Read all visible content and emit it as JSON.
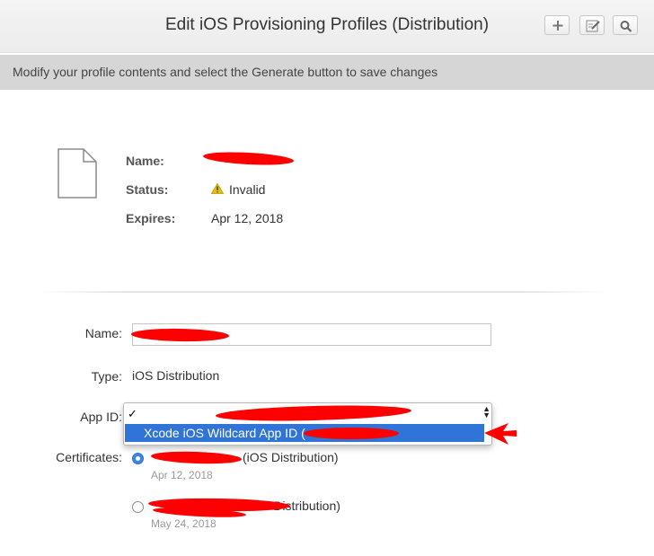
{
  "header": {
    "title": "Edit iOS Provisioning Profiles (Distribution)",
    "buttons": [
      {
        "name": "add",
        "icon": "plus-icon"
      },
      {
        "name": "edit",
        "icon": "pencil-icon"
      },
      {
        "name": "search",
        "icon": "search-icon"
      }
    ]
  },
  "banner": {
    "text": "Modify your profile contents and select the Generate button to save changes"
  },
  "profile_summary": {
    "icon": "document-icon",
    "name_label": "Name:",
    "name_value": "",
    "status_label": "Status:",
    "status_icon": "warning-icon",
    "status_value": "Invalid",
    "expires_label": "Expires:",
    "expires_value": "Apr 12, 2018"
  },
  "form": {
    "name_label": "Name:",
    "name_value": "",
    "type_label": "Type:",
    "type_value": "iOS Distribution",
    "app_id_label": "App ID:",
    "app_id_dropdown": {
      "checkmark": "✓",
      "options": [
        "",
        "Xcode iOS Wildcard App ID ("
      ],
      "highlighted_option": "Xcode iOS Wildcard App ID ("
    },
    "certificates_label": "Certificates:",
    "certificates": [
      {
        "name": "(iOS Distribution)",
        "date": "Apr 12, 2018",
        "selected": true
      },
      {
        "name": "iOS Distribution)",
        "date": "May 24, 2018",
        "selected": false
      }
    ]
  },
  "colors": {
    "accent": "#2f74d6",
    "redaction": "#ff0000",
    "banner_bg": "#d6d6d6",
    "warning": "#e6c200"
  }
}
